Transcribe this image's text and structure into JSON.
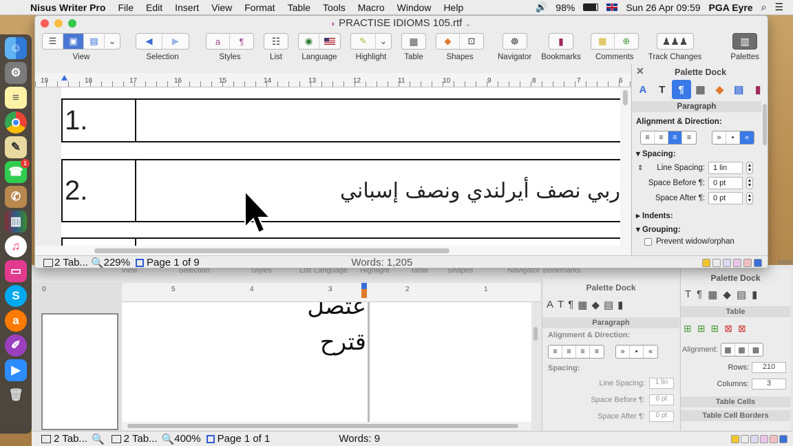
{
  "menubar": {
    "app_name": "Nisus Writer Pro",
    "items": [
      "File",
      "Edit",
      "Insert",
      "View",
      "Format",
      "Table",
      "Tools",
      "Macro",
      "Window",
      "Help"
    ],
    "battery": "98%",
    "datetime": "Sun 26 Apr  09:59",
    "user": "PGA Eyre"
  },
  "window": {
    "title": "PRACTISE IDIOMS 105.rtf",
    "title_suffix": "⌄"
  },
  "toolbar": {
    "view": "View",
    "selection": "Selection",
    "styles": "Styles",
    "list": "List",
    "language": "Language",
    "highlight": "Highlight",
    "table": "Table",
    "shapes": "Shapes",
    "navigator": "Navigator",
    "bookmarks": "Bookmarks",
    "comments": "Comments",
    "track_changes": "Track Changes",
    "palettes": "Palettes"
  },
  "ruler": {
    "numbers": [
      "19",
      "18",
      "17",
      "16",
      "15",
      "14",
      "13",
      "12",
      "11",
      "10",
      "9",
      "8",
      "7",
      "6"
    ]
  },
  "document": {
    "rows": [
      {
        "number": "1.",
        "text": ""
      },
      {
        "number": "2.",
        "text": "ربي نصف أيرلندي ونصف إسباني"
      }
    ]
  },
  "statusbar": {
    "tabs_label": "2 Tab...",
    "zoom": "229%",
    "page": "Page 1 of 9",
    "words": "Words: 1,205"
  },
  "palette": {
    "title": "Palette Dock",
    "section": "Paragraph",
    "alignment_heading": "Alignment & Direction:",
    "spacing_heading": "Spacing:",
    "line_spacing_label": "Line Spacing:",
    "line_spacing_value": "1 lin",
    "space_before_label": "Space Before ¶:",
    "space_before_value": "0 pt",
    "space_after_label": "Space After ¶:",
    "space_after_value": "0 pt",
    "indents_heading": "Indents:",
    "grouping_heading": "Grouping:",
    "prevent_widow": "Prevent widow/orphan"
  },
  "back_window": {
    "toolbar_labels": [
      "View",
      "Selection",
      "Styles",
      "List",
      "Language",
      "Highlight",
      "Table",
      "Shapes",
      "Navigator",
      "Bookmarks"
    ],
    "ruler_numbers": [
      "0",
      "5",
      "4",
      "3",
      "2",
      "1"
    ],
    "arabic_line1": "عتصل",
    "arabic_line2": "قترح",
    "tabs_label": "2 Tab...",
    "tabs_label_2": "2 Tab...",
    "zoom": "400%",
    "page": "Page 1 of 1",
    "words": "Words: 9",
    "palette_title": "Palette Dock",
    "palette_section": "Paragraph",
    "alignment_heading": "Alignment & Direction:",
    "spacing_heading": "Spacing:",
    "line_spacing_label": "Line Spacing:",
    "line_spacing_value": "1 lin",
    "space_before_label": "Space Before ¶:",
    "space_before_value": "0 pt",
    "space_after_label": "Space After ¶:",
    "space_after_value": "0 pt",
    "table_palette_title": "Palette Dock",
    "table_section": "Table",
    "alignment_label": "Alignment:",
    "rows_label": "Rows:",
    "rows_value": "210",
    "columns_label": "Columns:",
    "columns_value": "3",
    "table_cells": "Table Cells",
    "table_cell_borders": "Table Cell Borders",
    "palettes_label": "ettes"
  },
  "dock_badge": "1",
  "colors": {
    "accent": "#3a7ae8",
    "close": "#fc605b",
    "minimize": "#fdbc40",
    "zoom": "#34c84a"
  }
}
